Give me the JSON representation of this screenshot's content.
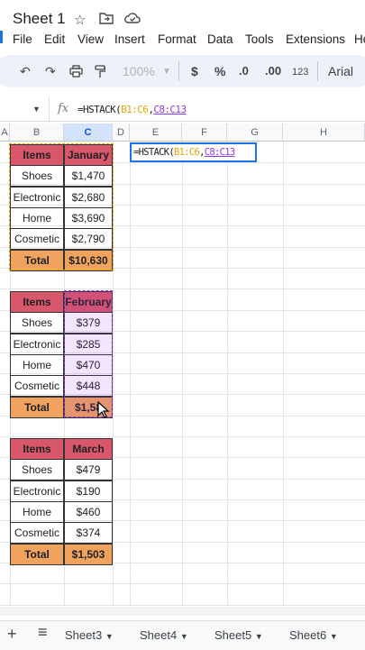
{
  "doc": {
    "title": "Sheet 1"
  },
  "menu": [
    "File",
    "Edit",
    "View",
    "Insert",
    "Format",
    "Data",
    "Tools",
    "Extensions",
    "He"
  ],
  "toolbar": {
    "zoom": "100%",
    "currency": "$",
    "percent": "%",
    "dec_less": ".0",
    "dec_more": ".00",
    "number_fmt": "123",
    "font": "Arial"
  },
  "formula_bar": {
    "fx": "fx",
    "prefix": "=HSTACK(",
    "ref1": "B1:C6",
    "comma": ",",
    "ref2": "C8:C13"
  },
  "editor": {
    "prefix": "=HSTACK(",
    "ref1": "B1:C6",
    "comma": ",",
    "ref2": "C8:C13"
  },
  "columns": [
    "A",
    "B",
    "C",
    "D",
    "E",
    "F",
    "G",
    "H"
  ],
  "tables": [
    {
      "header": [
        "Items",
        "January"
      ],
      "color": "#d9576a",
      "rows": [
        [
          "Shoes",
          "$1,470"
        ],
        [
          "Electronic",
          "$2,680"
        ],
        [
          "Home",
          "$3,690"
        ],
        [
          "Cosmetic",
          "$2,790"
        ]
      ],
      "total": [
        "Total",
        "$10,630"
      ]
    },
    {
      "header": [
        "Items",
        "February"
      ],
      "color": "#d9576a",
      "rows": [
        [
          "Shoes",
          "$379"
        ],
        [
          "Electronic",
          "$285"
        ],
        [
          "Home",
          "$470"
        ],
        [
          "Cosmetic",
          "$448"
        ]
      ],
      "total": [
        "Total",
        "$1,58"
      ]
    },
    {
      "header": [
        "Items",
        "March"
      ],
      "color": "#d9576a",
      "rows": [
        [
          "Shoes",
          "$479"
        ],
        [
          "Electronic",
          "$190"
        ],
        [
          "Home",
          "$460"
        ],
        [
          "Cosmetic",
          "$374"
        ]
      ],
      "total": [
        "Total",
        "$1,503"
      ]
    }
  ],
  "sheets": [
    "Sheet3",
    "Sheet4",
    "Sheet5",
    "Sheet6"
  ]
}
